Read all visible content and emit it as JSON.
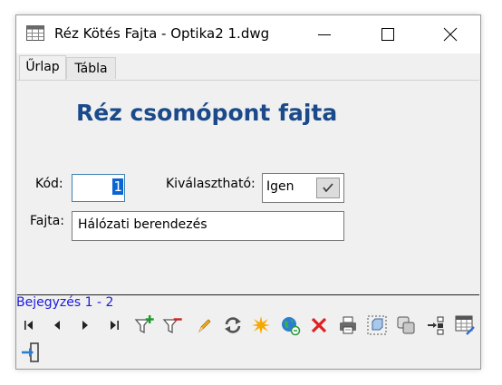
{
  "window": {
    "title": "Réz Kötés Fajta - Optika2 1.dwg"
  },
  "tabs": [
    {
      "label": "Űrlap"
    },
    {
      "label": "Tábla"
    }
  ],
  "form": {
    "heading": "Réz csomópont fajta",
    "code_label": "Kód:",
    "code_value": "1",
    "selectable_label": "Kiválasztható:",
    "selectable_value": "Igen",
    "selectable_checked": true,
    "type_label": "Fajta:",
    "type_value": "Hálózati berendezés"
  },
  "status": {
    "record_text": "Bejegyzés 1 - 2"
  },
  "toolbar": {
    "icons": [
      "first-record-icon",
      "previous-record-icon",
      "next-record-icon",
      "last-record-icon",
      "add-filter-icon",
      "remove-filter-icon",
      "edit-pencil-icon",
      "refresh-icon",
      "highlight-star-icon",
      "zoom-globe-icon",
      "delete-icon",
      "print-icon",
      "select-object-icon",
      "copy-objects-icon",
      "link-icon",
      "table-settings-icon",
      "exit-icon"
    ]
  },
  "colors": {
    "heading": "#1a4a8a",
    "status_text": "#1a1ae0",
    "selection": "#0a64d2",
    "delete_red": "#e02020",
    "refresh_gray": "#505050"
  }
}
